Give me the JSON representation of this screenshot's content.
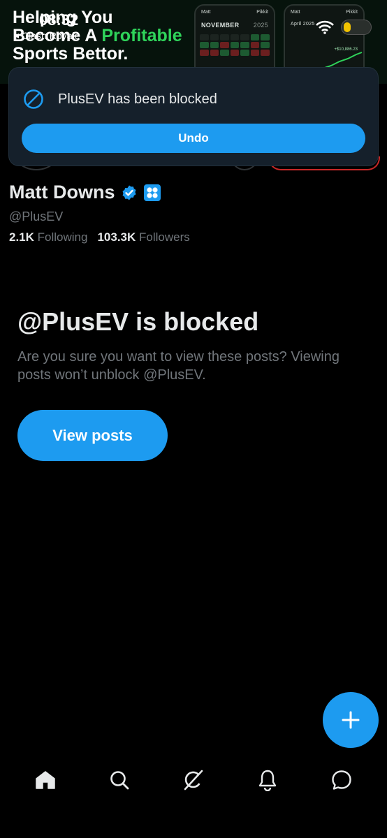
{
  "status_bar": {
    "time": "08:32",
    "back_app": "Clash Royale",
    "battery_level_pct": 25
  },
  "banner": {
    "line1": "Helping You",
    "line2_prefix": "Become A ",
    "line2_highlight": "Profitable",
    "line3": "Sports Bettor",
    "line3_dot": ".",
    "mock1": {
      "user": "Matt",
      "brand": "Pikkit",
      "month": "NOVEMBER",
      "year": "2025"
    },
    "mock2": {
      "user": "Matt",
      "brand": "Pikkit",
      "month": "April 2025",
      "value": "+$10,886.23"
    }
  },
  "toast": {
    "message": "PlusEV has been blocked",
    "undo_label": "Undo",
    "icon": "blocked-icon"
  },
  "profile": {
    "name": "Matt Downs",
    "handle": "@PlusEV",
    "following_count": "2.1K",
    "following_label": "Following",
    "followers_count": "103.3K",
    "followers_label": "Followers",
    "badges": [
      "verified-badge-icon",
      "affiliate-badge-icon"
    ]
  },
  "blocked": {
    "title": "@PlusEV is blocked",
    "description": "Are you sure you want to view these posts? Viewing posts won’t unblock @PlusEV.",
    "view_posts_label": "View posts"
  },
  "fab": {
    "icon": "plus-icon"
  },
  "bottom_nav": {
    "items": [
      "home-icon",
      "search-icon",
      "grok-icon",
      "notifications-bell-icon",
      "messages-icon"
    ]
  },
  "colors": {
    "accent": "#1d9bf0",
    "background": "#000000",
    "toast_bg": "#15202b",
    "muted_text": "#71767b",
    "banner_highlight": "#2fd35a"
  }
}
